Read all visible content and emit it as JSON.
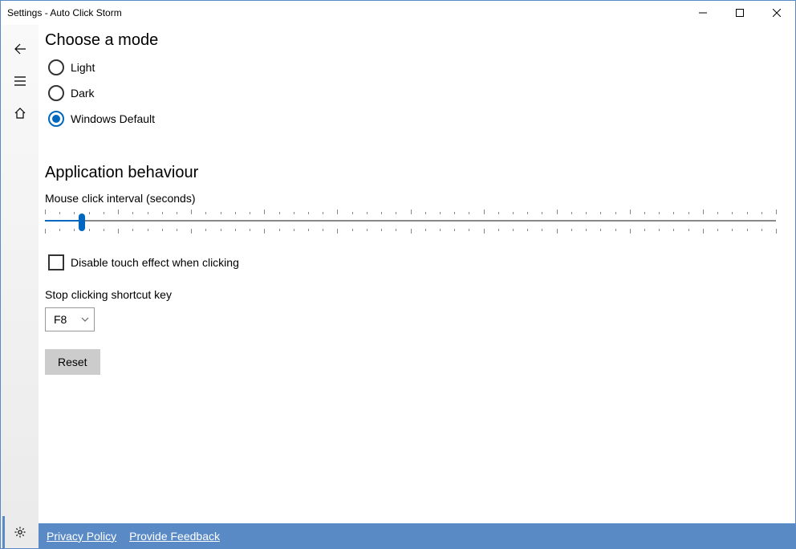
{
  "window": {
    "title": "Settings - Auto Click Storm"
  },
  "mode_section": {
    "title": "Choose a mode",
    "options": [
      {
        "label": "Light",
        "checked": false
      },
      {
        "label": "Dark",
        "checked": false
      },
      {
        "label": "Windows Default",
        "checked": true
      }
    ]
  },
  "behaviour_section": {
    "title": "Application behaviour",
    "interval_label": "Mouse click interval (seconds)",
    "slider": {
      "min": 0,
      "max": 100,
      "value": 5,
      "major_ticks": 11,
      "minor_per_major": 4
    },
    "disable_touch_label": "Disable touch effect when clicking",
    "disable_touch_checked": false,
    "shortcut_label": "Stop clicking shortcut key",
    "shortcut_value": "F8",
    "reset_label": "Reset"
  },
  "footer": {
    "privacy": "Privacy Policy",
    "feedback": "Provide Feedback"
  }
}
